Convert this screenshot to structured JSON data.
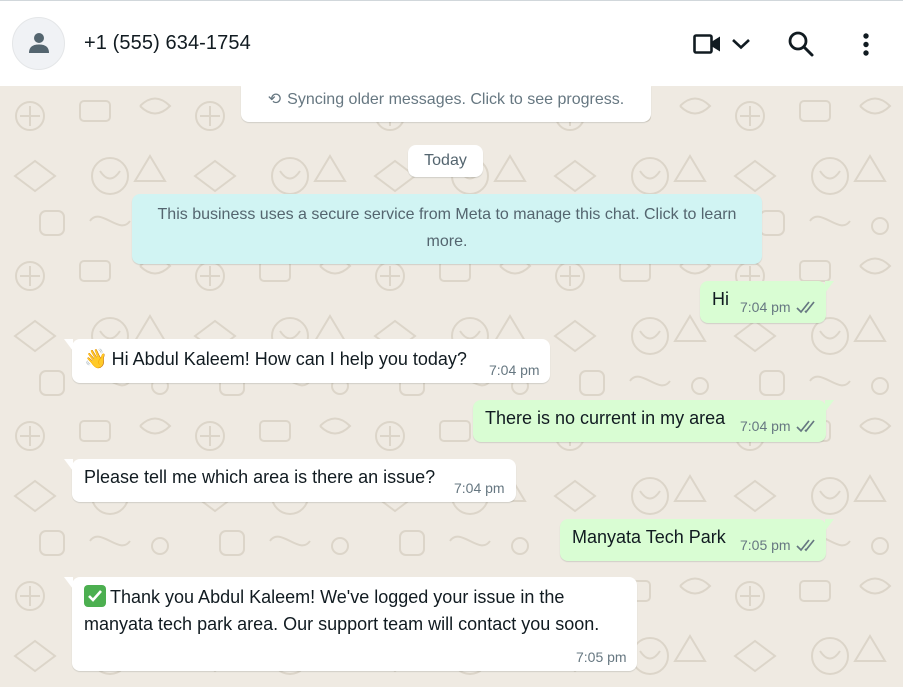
{
  "header": {
    "contact": "+1 (555) 634-1754",
    "icons": [
      "person-icon",
      "video-call-icon",
      "chevron-down-icon",
      "search-icon",
      "menu-dots-icon"
    ]
  },
  "chat": {
    "sync_notice": "Syncing older messages. Click to see progress.",
    "date_label": "Today",
    "system_message": "This business uses a secure service from Meta to manage this chat. Click to learn more.",
    "messages": [
      {
        "direction": "out",
        "text": "Hi",
        "time": "7:04 pm",
        "status": "read"
      },
      {
        "direction": "in",
        "emoji": "👋",
        "text": "Hi Abdul Kaleem! How can I help you today?",
        "time": "7:04 pm"
      },
      {
        "direction": "out",
        "text": "There is no current in my area",
        "time": "7:04 pm",
        "status": "read"
      },
      {
        "direction": "in",
        "text": "Please tell me which area is there an issue?",
        "time": "7:04 pm"
      },
      {
        "direction": "out",
        "text": "Manyata Tech Park",
        "time": "7:05 pm",
        "status": "read"
      },
      {
        "direction": "in",
        "emoji": "check-mark-button",
        "text": "Thank you Abdul Kaleem! We've logged your issue in the manyata tech park area. Our support team will contact you soon.",
        "time": "7:05 pm"
      }
    ]
  },
  "colors": {
    "chat_background": "#efeae2",
    "outgoing_bubble": "#d9fdd3",
    "incoming_bubble": "#ffffff",
    "system_bubble": "#d1f4f3",
    "read_ticks": "#667781"
  }
}
